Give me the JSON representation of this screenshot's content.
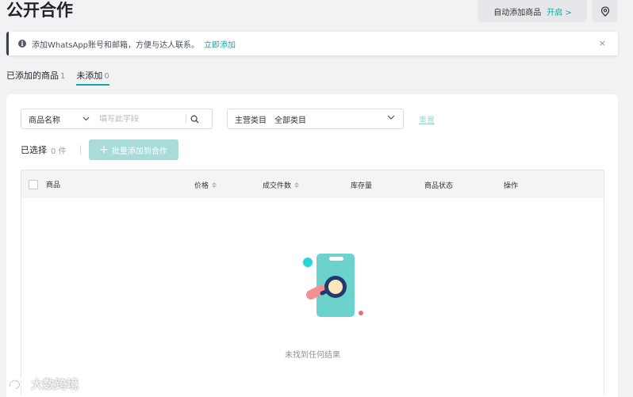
{
  "page": {
    "title": "公开合作"
  },
  "header": {
    "auto_add_label": "自动添加商品",
    "auto_add_status": "开启 >",
    "pin_icon": "location-pin-icon"
  },
  "notice": {
    "text": "添加WhatsApp账号和邮箱，方便与达人联系。",
    "link": "立即添加",
    "close": "×",
    "icon": "info-icon"
  },
  "tabs": [
    {
      "label": "已添加的商品",
      "count": "1",
      "active": false
    },
    {
      "label": "未添加",
      "count": "0",
      "active": true
    }
  ],
  "filters": {
    "field_select": "商品名称",
    "search_placeholder": "填写此字段",
    "category_label": "主营类目",
    "category_value": "全部类目",
    "reset": "重置"
  },
  "selection": {
    "label": "已选择",
    "count": "0 件",
    "batch_button": "批量添加到合作"
  },
  "table": {
    "columns": [
      "商品",
      "价格",
      "成交件数",
      "库存量",
      "商品状态",
      "操作"
    ],
    "empty_text": "未找到任何结果"
  },
  "watermark": {
    "text": "大数跨境"
  },
  "colors": {
    "accent": "#1aa5a2",
    "accent_disabled": "#a9dbd9"
  }
}
